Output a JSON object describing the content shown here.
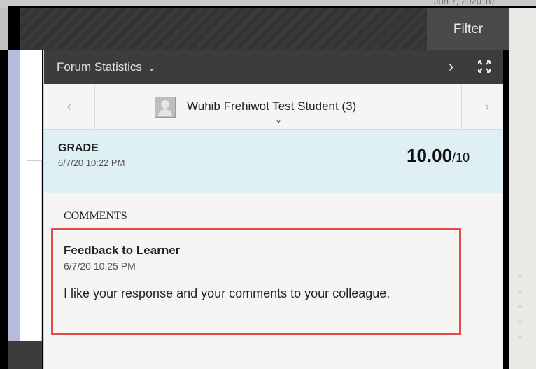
{
  "background": {
    "date_fragment": "Jun 7, 2020 10"
  },
  "toolbar": {
    "filter_label": "Filter"
  },
  "panel": {
    "title": "Forum Statistics",
    "title_chevron": "⌄",
    "next_icon": "›",
    "expand_icon": "expand-icon"
  },
  "student": {
    "prev_icon": "‹",
    "next_icon": "›",
    "name": "Wuhib Frehiwot Test Student (3)",
    "dropdown_icon": "⌄"
  },
  "grade": {
    "label": "GRADE",
    "date": "6/7/20 10:22 PM",
    "score": "10.00",
    "max": "/10"
  },
  "comments": {
    "label": "COMMENTS",
    "items": [
      {
        "title": "Feedback to Learner",
        "date": "6/7/20 10:25 PM",
        "text": "I like your response and your comments to your colleague."
      }
    ]
  },
  "colors": {
    "header_dark": "#3c3c3c",
    "grade_bg": "#dff0f5",
    "highlight_border": "#e24b4b"
  }
}
